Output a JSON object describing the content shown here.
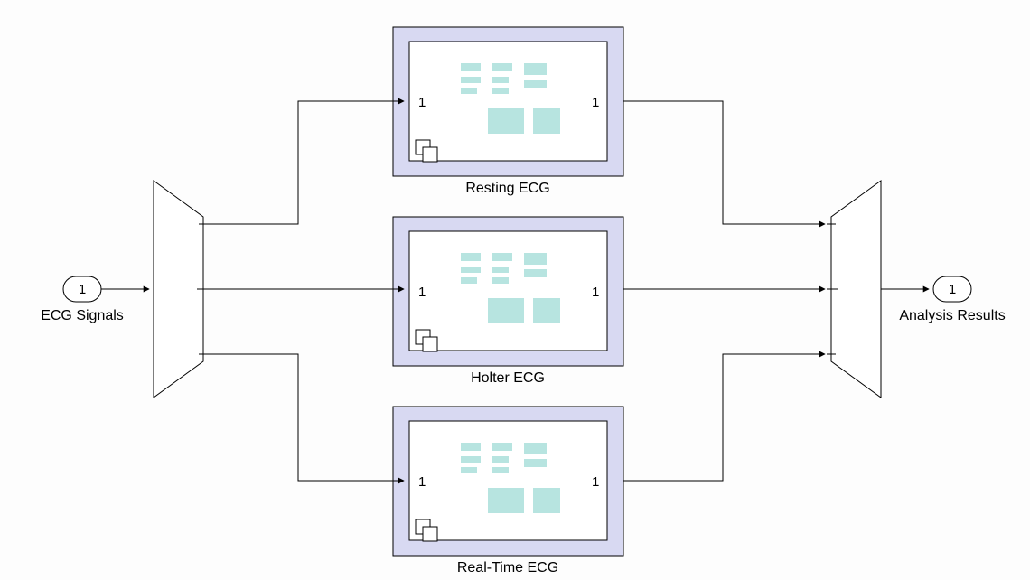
{
  "input": {
    "port": "1",
    "label": "ECG Signals"
  },
  "output": {
    "port": "1",
    "label": "Analysis Results"
  },
  "variants": [
    {
      "label": "Resting ECG",
      "in_port": "1",
      "out_port": "1"
    },
    {
      "label": "Holter ECG",
      "in_port": "1",
      "out_port": "1"
    },
    {
      "label": "Real-Time ECG",
      "in_port": "1",
      "out_port": "1"
    }
  ]
}
